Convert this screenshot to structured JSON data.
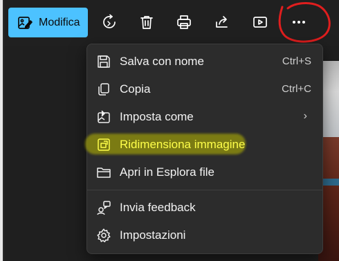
{
  "toolbar": {
    "edit_label": "Modifica",
    "icons": [
      "edit-photo-icon",
      "rotate-icon",
      "delete-icon",
      "print-icon",
      "share-icon",
      "slideshow-icon",
      "more-options-icon"
    ]
  },
  "menu": {
    "items": [
      {
        "label": "Salva con nome",
        "shortcut": "Ctrl+S",
        "icon": "save-icon"
      },
      {
        "label": "Copia",
        "shortcut": "Ctrl+C",
        "icon": "copy-icon"
      },
      {
        "label": "Imposta come",
        "submenu": "›",
        "icon": "set-as-icon"
      },
      {
        "label": "Ridimensiona immagine",
        "icon": "resize-image-icon"
      },
      {
        "label": "Apri in Esplora file",
        "icon": "folder-icon"
      },
      {
        "label": "Invia feedback",
        "icon": "feedback-icon"
      },
      {
        "label": "Impostazioni",
        "icon": "settings-icon"
      }
    ]
  },
  "colors": {
    "accent": "#4cc2ff",
    "menu_bg": "#2c2c2c",
    "highlight": "#bebe00",
    "annotation": "#e01e1e"
  }
}
